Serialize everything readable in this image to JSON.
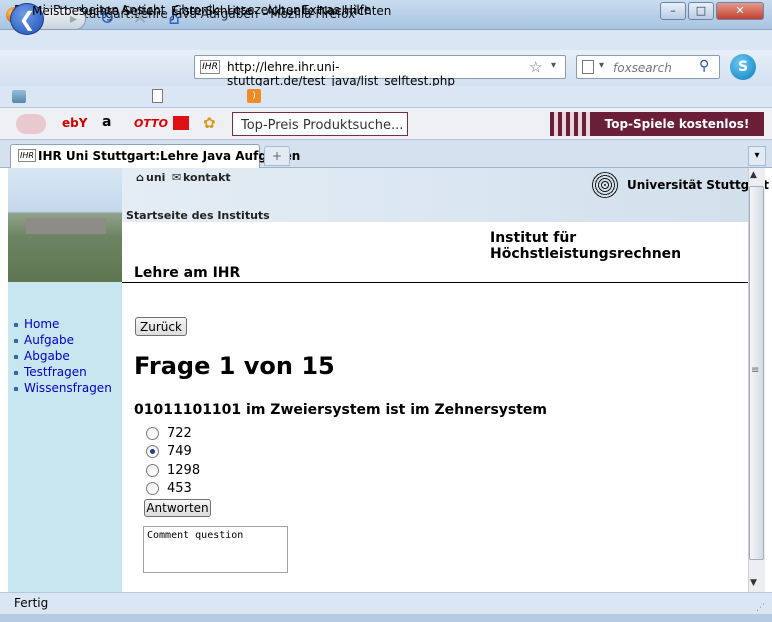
{
  "window": {
    "title": "IHR Uni Stuttgart:Lehre Java Aufgaben - Mozilla Firefox"
  },
  "menu": [
    "Datei",
    "Bearbeiten",
    "Ansicht",
    "Chronik",
    "Lesezeichen",
    "Extras",
    "Hilfe"
  ],
  "navigation": {
    "url": "http://lehre.ihr.uni-stuttgart.de/test_java/list_selftest.php",
    "search_placeholder": "foxsearch"
  },
  "bookmarks": [
    "Meistbesuchte Seiten",
    "Erste Schritte",
    "Aktuelle Nachrichten"
  ],
  "toolbar2": {
    "search_placeholder": "Top-Preis Produktsuche...",
    "banner": "Top-Spiele kostenlos!"
  },
  "tab": {
    "label": "IHR Uni Stuttgart:Lehre Java Aufgaben"
  },
  "page": {
    "header_links": [
      "uni",
      "kontakt"
    ],
    "uni_name": "Universität Stuttgart",
    "startseite": "Startseite des Instituts",
    "institut": "Institut für Höchstleistungsrechnen",
    "section": "Lehre am IHR",
    "nav": [
      "Home",
      "Aufgabe",
      "Abgabe",
      "Testfragen",
      "Wissensfragen"
    ],
    "back_button": "Zurück",
    "question_title": "Frage 1 von 15",
    "question_text": "01011101101 im Zweiersystem ist im Zehnersystem",
    "options": [
      "722",
      "749",
      "1298",
      "453"
    ],
    "selected_option": "749",
    "answer_button": "Antworten",
    "comment": "Comment question"
  },
  "status": "Fertig"
}
